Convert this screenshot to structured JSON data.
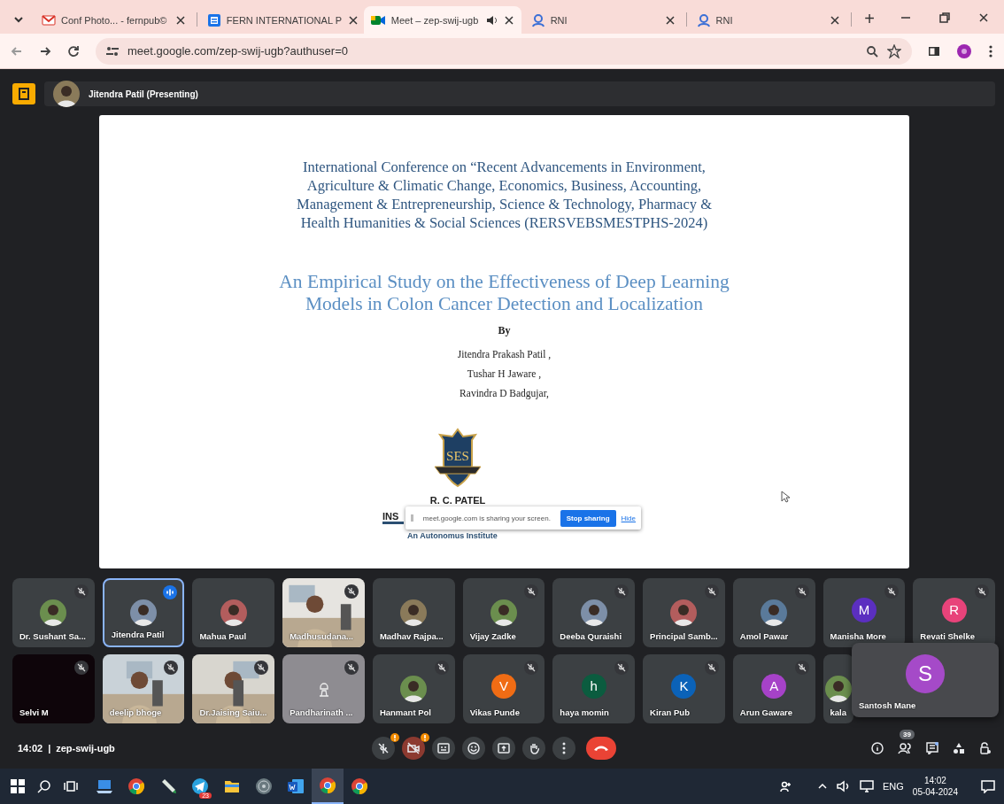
{
  "browser": {
    "tabs": [
      {
        "title": "Conf Photo... - fernpub©",
        "selected": false,
        "audio": false
      },
      {
        "title": "FERN INTERNATIONAL P",
        "selected": false,
        "audio": false
      },
      {
        "title": "Meet – zep-swij-ugb",
        "selected": true,
        "audio": true
      },
      {
        "title": "RNI",
        "selected": false,
        "audio": false
      },
      {
        "title": "RNI",
        "selected": false,
        "audio": false
      }
    ],
    "new_tab": "+",
    "url": "meet.google.com/zep-swij-ugb?authuser=0"
  },
  "presenting": "Jitendra Patil (Presenting)",
  "slide": {
    "conference_lines": [
      "International Conference on  “Recent Advancements in Environment,",
      "Agriculture & Climatic Change, Economics, Business, Accounting,",
      "Management & Entrepreneurship, Science & Technology, Pharmacy &",
      "Health Humanities & Social Sciences (RERSVEBSMESTPHS-2024)"
    ],
    "title_lines": [
      "An Empirical Study on the Effectiveness of Deep Learning",
      "Models in Colon Cancer Detection and Localization"
    ],
    "by": "By",
    "authors": [
      "Jitendra Prakash Patil ,",
      "Tushar H Jaware  ,",
      "Ravindra D Badgujar,"
    ],
    "logo_text": "SES",
    "institute": "R. C. PATEL",
    "institute_cut": "INS",
    "tagline": "An Autonomus Institute",
    "share_banner": {
      "message": "meet.google.com is sharing your screen.",
      "stop": "Stop sharing",
      "hide": "Hide"
    }
  },
  "participants": [
    {
      "name": "Dr. Sushant Sa...",
      "kind": "avatar",
      "muted": true,
      "speaking": false
    },
    {
      "name": "Jitendra Patil",
      "kind": "avatar",
      "muted": false,
      "speaking": true
    },
    {
      "name": "Mahua Paul",
      "kind": "avatar",
      "muted": false,
      "speaking": false
    },
    {
      "name": "Madhusudana...",
      "kind": "video",
      "muted": true,
      "speaking": false
    },
    {
      "name": "Madhav Rajpa...",
      "kind": "avatar",
      "muted": false,
      "speaking": false
    },
    {
      "name": "Vijay Zadke",
      "kind": "avatar",
      "muted": true,
      "speaking": false
    },
    {
      "name": "Deeba Quraishi",
      "kind": "avatar",
      "muted": true,
      "speaking": false
    },
    {
      "name": "Principal Samb...",
      "kind": "avatar",
      "muted": true,
      "speaking": false
    },
    {
      "name": "Amol Pawar",
      "kind": "avatar",
      "muted": true,
      "speaking": false
    },
    {
      "name": "Manisha More",
      "kind": "letter",
      "letter": "M",
      "color": "#5b2fc0",
      "muted": true,
      "speaking": false
    },
    {
      "name": "Revati Shelke",
      "kind": "letter",
      "letter": "R",
      "color": "#e8437a",
      "muted": true,
      "speaking": false
    },
    {
      "name": "Selvi M",
      "kind": "blank",
      "muted": true,
      "speaking": false
    },
    {
      "name": "deelip bhoge",
      "kind": "video",
      "muted": true,
      "speaking": false
    },
    {
      "name": "Dr.Jaising Saiu...",
      "kind": "video",
      "muted": true,
      "speaking": false
    },
    {
      "name": "Pandharinath ...",
      "kind": "placeholder",
      "muted": true,
      "speaking": false
    },
    {
      "name": "Hanmant Pol",
      "kind": "avatar",
      "muted": true,
      "speaking": false
    },
    {
      "name": "Vikas Punde",
      "kind": "letter",
      "letter": "V",
      "color": "#f06c14",
      "muted": true,
      "speaking": false
    },
    {
      "name": "haya momin",
      "kind": "letter",
      "letter": "h",
      "color": "#0b5c3f",
      "muted": true,
      "speaking": false
    },
    {
      "name": "Kiran Pub",
      "kind": "letter",
      "letter": "K",
      "color": "#0b62b8",
      "muted": true,
      "speaking": false
    },
    {
      "name": "Arun Gaware",
      "kind": "letter",
      "letter": "A",
      "color": "#a642c8",
      "muted": true,
      "speaking": false
    },
    {
      "name": "kala",
      "kind": "avatar",
      "muted": false,
      "speaking": false
    }
  ],
  "self_view": {
    "name": "Santosh Mane",
    "letter": "S",
    "color": "#a54ac8"
  },
  "meeting_bar": {
    "time": "14:02",
    "separator": "|",
    "code": "zep-swij-ugb",
    "controls": [
      {
        "kind": "mic",
        "on": false
      },
      {
        "kind": "camera",
        "on": false
      },
      {
        "kind": "captions"
      },
      {
        "kind": "emoji"
      },
      {
        "kind": "present"
      },
      {
        "kind": "hand"
      },
      {
        "kind": "more"
      },
      {
        "kind": "end"
      }
    ],
    "people_count": "39"
  },
  "taskbar": {
    "apps": [
      {
        "kind": "explorer",
        "active": false
      },
      {
        "kind": "chrome",
        "active": false
      },
      {
        "kind": "pen",
        "active": false
      },
      {
        "kind": "telegram",
        "active": false,
        "badge": "23"
      },
      {
        "kind": "files",
        "active": false
      },
      {
        "kind": "disc",
        "active": false
      },
      {
        "kind": "word",
        "active": false
      },
      {
        "kind": "chrome",
        "active": true
      },
      {
        "kind": "chrome",
        "active": false
      }
    ],
    "language": "ENG",
    "time": "14:02",
    "date": "05-04-2024"
  }
}
